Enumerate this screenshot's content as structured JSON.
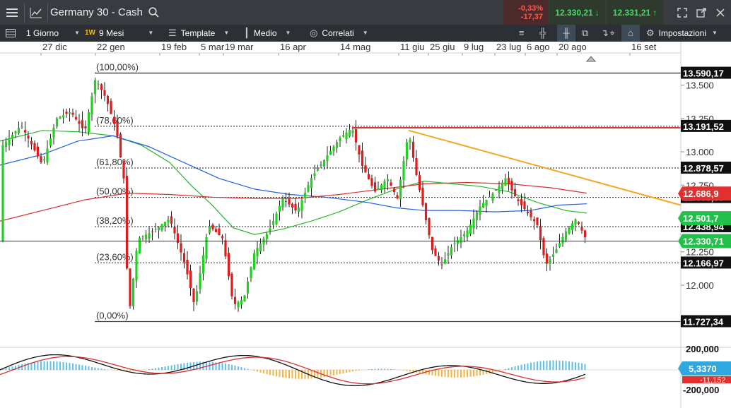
{
  "header": {
    "title": "Germany 30 - Cash",
    "change_pct": "-0,33%",
    "change_pts": "-17,37",
    "sell_price": "12.330,21",
    "buy_price": "12.331,21"
  },
  "toolbar": {
    "timeframe": "1 Giorno",
    "period_badge": "1W",
    "period": "9 Mesi",
    "template_label": "Template",
    "medio_label": "Medio",
    "correlati_label": "Correlati",
    "impostazioni_label": "Impostazioni"
  },
  "colors": {
    "up_candle": "#22d022",
    "down_candle": "#e01b1b",
    "ma_green": "#27b627",
    "ma_blue": "#1f5fe0",
    "ma_red": "#d43030",
    "trendline": "#f5a623",
    "sell_red": "#e23030",
    "buy_green": "#22c04b",
    "histogram_orange": "#f5a623",
    "histogram_cyan": "#3fb6e8"
  },
  "chart_data": {
    "type": "candlestick",
    "x_dates": [
      "27 dic",
      "22 gen",
      "19 feb",
      "5 mar",
      "19 mar",
      "16 apr",
      "14 mag",
      "11 giu",
      "25 giu",
      "9 lug",
      "23 lug",
      "6 ago",
      "20 ago",
      "16 set"
    ],
    "y_range": [
      11550,
      13720
    ],
    "y_ticks": [
      "13.500",
      "13.250",
      "13.000",
      "12.750",
      "12.500",
      "12.250",
      "12.000"
    ],
    "fib_levels": [
      {
        "label": "(100,00%)",
        "value": "13.590,17"
      },
      {
        "label": "(78,60%)",
        "value": "13.191,52"
      },
      {
        "label": "(61,80%)",
        "value": "12.878,57"
      },
      {
        "label": "(50,00%)",
        "value": "12.658,00"
      },
      {
        "label": "(38,20%)",
        "value": "12.438,94"
      },
      {
        "label": "(23,60%)",
        "value": "12.166,97"
      },
      {
        "label": "(0,00%)",
        "value": "11.727,34"
      }
    ],
    "price_tags": {
      "red": "12.686,9",
      "green": "12.501,7",
      "current": "12.330,71"
    },
    "resistance_value": 13180,
    "trendline_values": [
      [
        13160,
        12600
      ]
    ],
    "oscillator": {
      "ticks": [
        "200,000",
        "-200,000"
      ],
      "tag_value": "5,3370",
      "tag_secondary": "-11,152"
    }
  }
}
